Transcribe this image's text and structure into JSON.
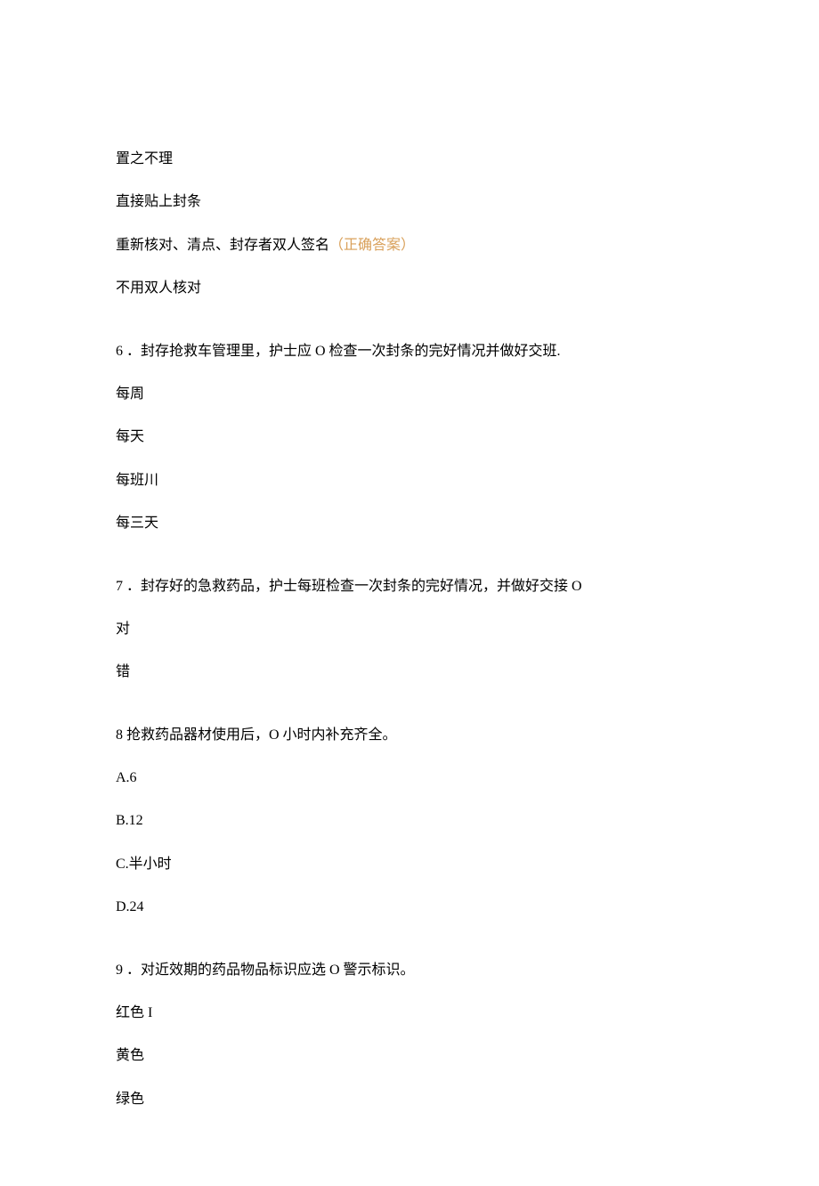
{
  "q5_trailing": {
    "opt1": "置之不理",
    "opt2": "直接贴上封条",
    "opt3_text": "重新核对、清点、封存者双人签名",
    "opt3_correct": "（正确答案）",
    "opt4": "不用双人核对"
  },
  "q6": {
    "stem": "6 ．封存抢救车管理里，护士应 O 检查一次封条的完好情况并做好交班.",
    "opt1": "每周",
    "opt2": "每天",
    "opt3": "每班川",
    "opt4": "每三天"
  },
  "q7": {
    "stem": "7 ．封存好的急救药品，护士每班检查一次封条的完好情况，并做好交接 O",
    "opt1": "对",
    "opt2": "错"
  },
  "q8": {
    "stem": "8 抢救药品器材使用后，O 小时内补充齐全。",
    "opt1": "A.6",
    "opt2": "B.12",
    "opt3": "C.半小时",
    "opt4": "D.24"
  },
  "q9": {
    "stem": "9 ．对近效期的药品物品标识应选 O 警示标识。",
    "opt1": "红色 I",
    "opt2": "黄色",
    "opt3": "绿色"
  }
}
